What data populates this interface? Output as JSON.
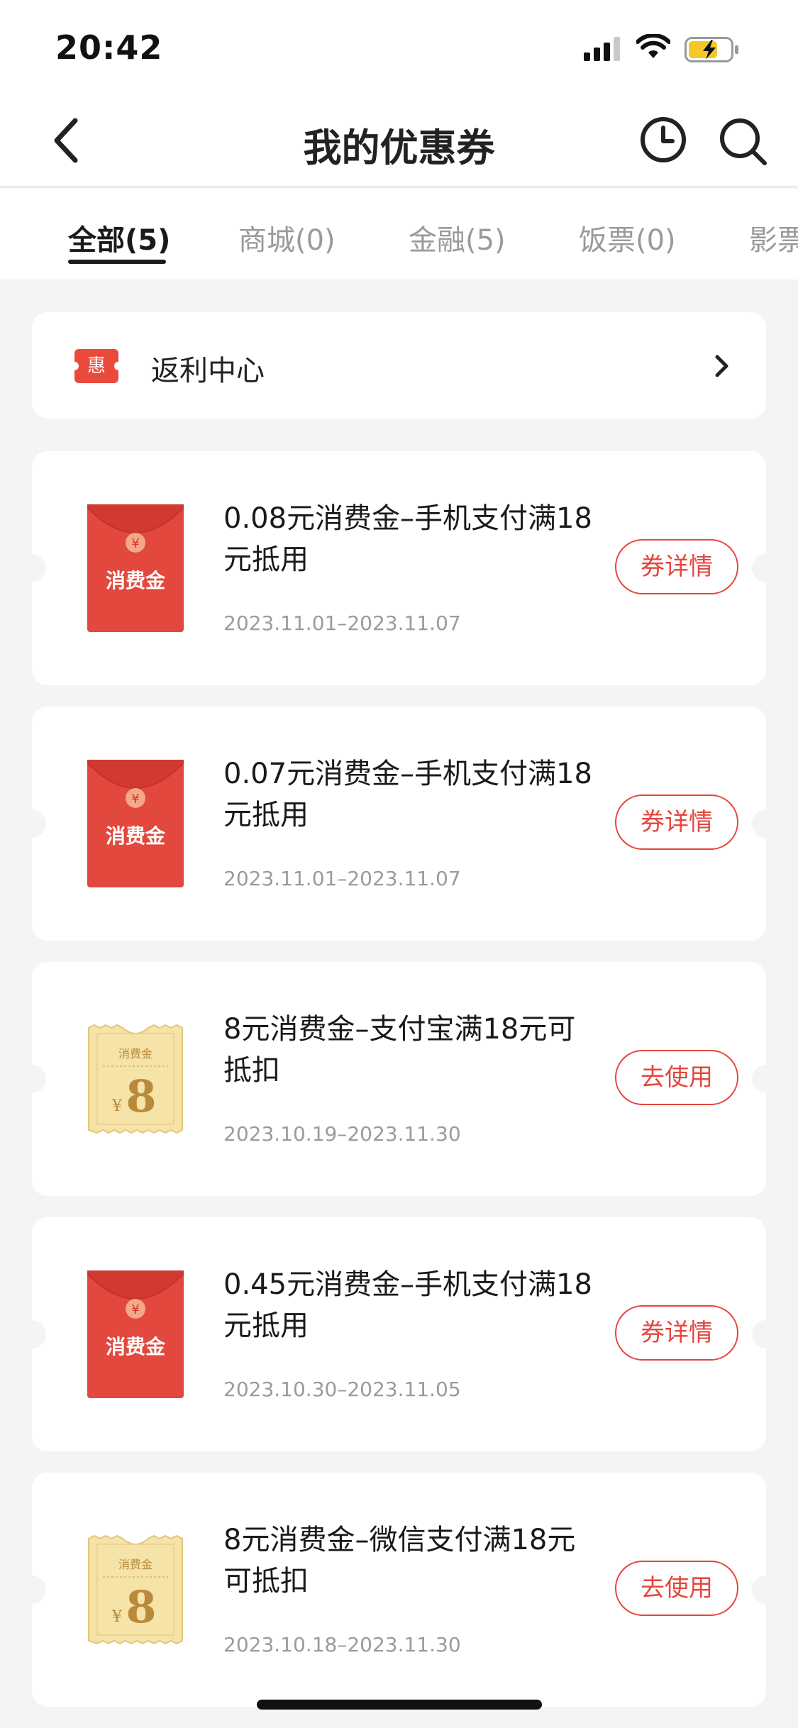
{
  "status_bar": {
    "time": "20:42"
  },
  "nav": {
    "title": "我的优惠券"
  },
  "tabs": [
    {
      "label": "全部(5)",
      "active": true
    },
    {
      "label": "商城(0)",
      "active": false
    },
    {
      "label": "金融(5)",
      "active": false
    },
    {
      "label": "饭票(0)",
      "active": false
    },
    {
      "label": "影票",
      "active": false
    }
  ],
  "rebate": {
    "badge": "惠",
    "label": "返利中心"
  },
  "coupons": [
    {
      "title": "0.08元消费金–手机支付满18元抵用",
      "date": "2023.11.01–2023.11.07",
      "button": "券详情",
      "thumb_type": "red-envelope",
      "thumb_label": "消费金",
      "thumb_symbol": "¥"
    },
    {
      "title": "0.07元消费金–手机支付满18元抵用",
      "date": "2023.11.01–2023.11.07",
      "button": "券详情",
      "thumb_type": "red-envelope",
      "thumb_label": "消费金",
      "thumb_symbol": "¥"
    },
    {
      "title": "8元消费金–支付宝满18元可抵扣",
      "date": "2023.10.19–2023.11.30",
      "button": "去使用",
      "thumb_type": "gold-ticket",
      "thumb_label": "消费金",
      "thumb_symbol": "¥",
      "thumb_amount": "8"
    },
    {
      "title": "0.45元消费金–手机支付满18元抵用",
      "date": "2023.10.30–2023.11.05",
      "button": "券详情",
      "thumb_type": "red-envelope",
      "thumb_label": "消费金",
      "thumb_symbol": "¥"
    },
    {
      "title": "8元消费金–微信支付满18元可抵扣",
      "date": "2023.10.18–2023.11.30",
      "button": "去使用",
      "thumb_type": "gold-ticket",
      "thumb_label": "消费金",
      "thumb_symbol": "¥",
      "thumb_amount": "8"
    }
  ],
  "icons": {
    "back": "chevron-left-icon",
    "history": "clock-icon",
    "search": "search-icon",
    "rebate_chevron": "chevron-right-icon",
    "signal": "cellular-signal-icon",
    "wifi": "wifi-icon",
    "battery": "battery-charging-icon"
  },
  "colors": {
    "accent_red": "#e4463d",
    "envelope_red": "#e2483d",
    "ticket_gold": "#f5e3a8",
    "battery_yellow": "#f4c829"
  }
}
